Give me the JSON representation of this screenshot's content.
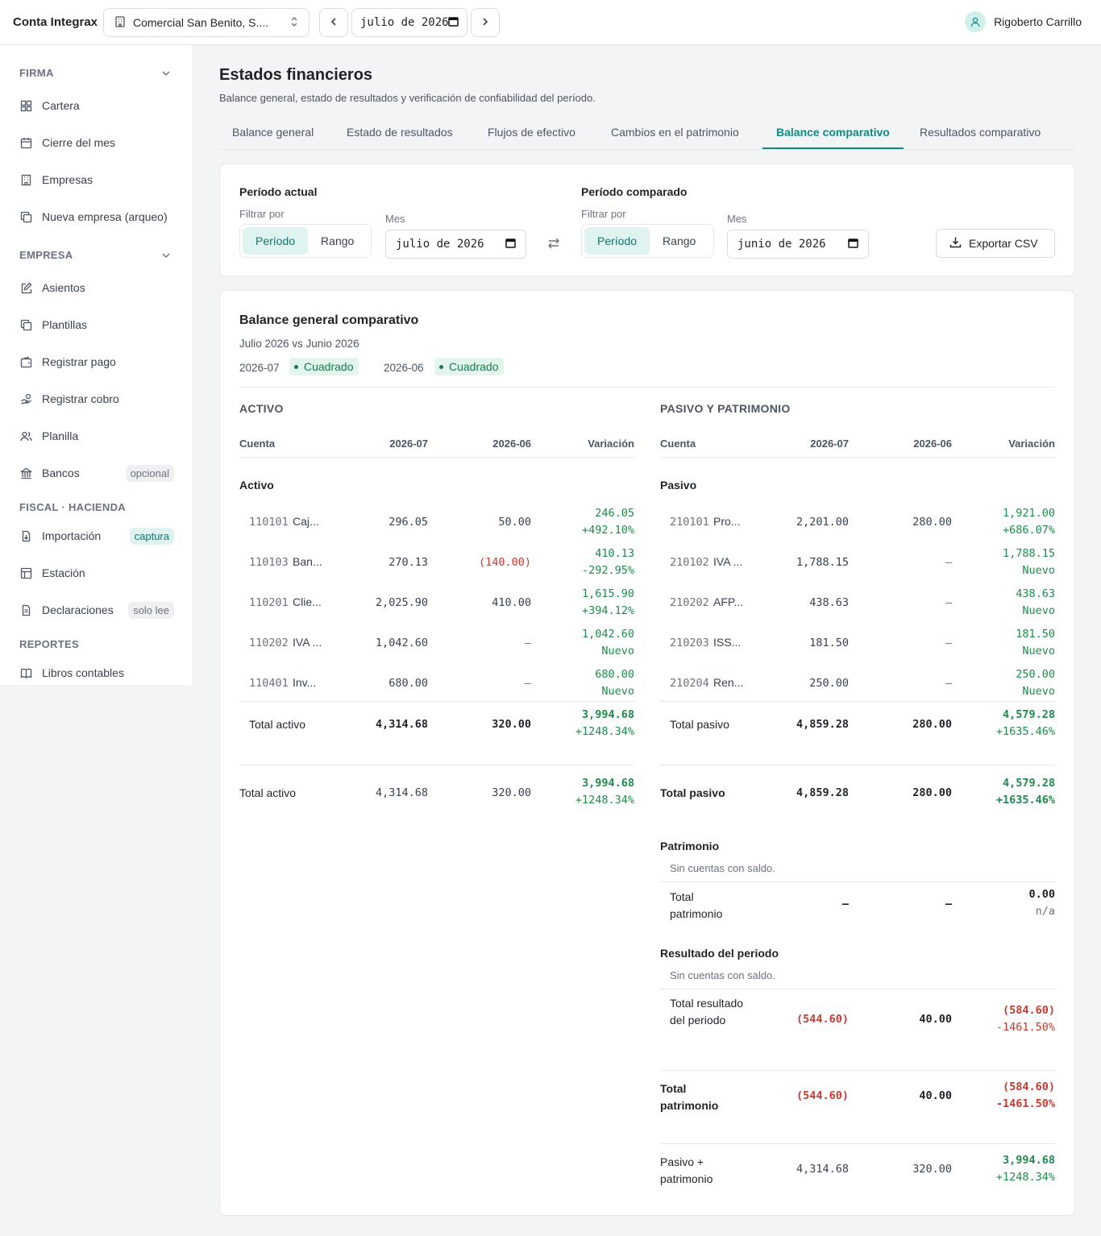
{
  "app": {
    "brand": "Conta Integrax",
    "company": "Comercial San Benito, S....",
    "month": "julio de 2026",
    "user": "Rigoberto Carrillo"
  },
  "sidebar": {
    "firma": {
      "title": "FIRMA",
      "items": [
        {
          "label": "Cartera",
          "icon": "grid-icon"
        },
        {
          "label": "Cierre del mes",
          "icon": "calendar-icon"
        },
        {
          "label": "Empresas",
          "icon": "building-icon"
        },
        {
          "label": "Nueva empresa (arqueo)",
          "icon": "copy-icon"
        }
      ]
    },
    "empresa": {
      "title": "EMPRESA",
      "items": [
        {
          "label": "Asientos",
          "icon": "edit-icon"
        },
        {
          "label": "Plantillas",
          "icon": "copy-icon"
        },
        {
          "label": "Registrar pago",
          "icon": "wallet-icon"
        },
        {
          "label": "Registrar cobro",
          "icon": "hand-coins-icon"
        },
        {
          "label": "Planilla",
          "icon": "users-icon"
        },
        {
          "label": "Bancos",
          "icon": "bank-icon",
          "pill": "opcional"
        }
      ]
    },
    "fiscal": {
      "title": "FISCAL · HACIENDA",
      "items": [
        {
          "label": "Importación",
          "icon": "file-import-icon",
          "pill": "captura"
        },
        {
          "label": "Estación",
          "icon": "table-icon"
        },
        {
          "label": "Declaraciones",
          "icon": "file-text-icon",
          "pill": "solo lee"
        }
      ]
    },
    "reportes": {
      "title": "REPORTES",
      "items": [
        {
          "label": "Libros contables",
          "icon": "book-icon"
        }
      ]
    }
  },
  "page": {
    "title": "Estados financieros",
    "subtitle": "Balance general, estado de resultados y verificación de confiabilidad del período.",
    "tabs": [
      "Balance general",
      "Estado de resultados",
      "Flujos de efectivo",
      "Cambios en el patrimonio",
      "Balance comparativo",
      "Resultados comparativo"
    ],
    "active_tab": "Balance comparativo"
  },
  "filters": {
    "actual": {
      "title": "Período actual",
      "filter_label": "Filtrar por",
      "opt1": "Período",
      "opt2": "Rango",
      "month_label": "Mes",
      "month": "julio de 2026"
    },
    "comparado": {
      "title": "Período comparado",
      "filter_label": "Filtrar por",
      "opt1": "Período",
      "opt2": "Rango",
      "month_label": "Mes",
      "month": "junio de 2026"
    },
    "export": "Exportar CSV"
  },
  "report": {
    "title": "Balance general comparativo",
    "subtitle": "Julio 2026 vs Junio 2026",
    "p1": "2026-07",
    "p1_status": "Cuadrado",
    "p2": "2026-06",
    "p2_status": "Cuadrado",
    "activo": {
      "heading": "ACTIVO",
      "cols": [
        "Cuenta",
        "2026-07",
        "2026-06",
        "Variación"
      ],
      "group": "Activo",
      "rows": [
        {
          "code": "110101",
          "name": "Caj...",
          "a": "296.05",
          "b": "50.00",
          "v": "246.05",
          "p": "+492.10%"
        },
        {
          "code": "110103",
          "name": "Ban...",
          "a": "270.13",
          "b": "(140.00)",
          "v": "410.13",
          "p": "-292.95%"
        },
        {
          "code": "110201",
          "name": "Clie...",
          "a": "2,025.90",
          "b": "410.00",
          "v": "1,615.90",
          "p": "+394.12%"
        },
        {
          "code": "110202",
          "name": "IVA ...",
          "a": "1,042.60",
          "b": "—",
          "v": "1,042.60",
          "p": "Nuevo"
        },
        {
          "code": "110401",
          "name": "Inv...",
          "a": "680.00",
          "b": "—",
          "v": "680.00",
          "p": "Nuevo"
        }
      ],
      "subtotal": {
        "label": "Total activo",
        "a": "4,314.68",
        "b": "320.00",
        "v": "3,994.68",
        "p": "+1248.34%"
      },
      "total": {
        "label": "Total activo",
        "a": "4,314.68",
        "b": "320.00",
        "v": "3,994.68",
        "p": "+1248.34%"
      }
    },
    "pasivo": {
      "heading": "PASIVO Y PATRIMONIO",
      "cols": [
        "Cuenta",
        "2026-07",
        "2026-06",
        "Variación"
      ],
      "group": "Pasivo",
      "rows": [
        {
          "code": "210101",
          "name": "Pro...",
          "a": "2,201.00",
          "b": "280.00",
          "v": "1,921.00",
          "p": "+686.07%"
        },
        {
          "code": "210102",
          "name": "IVA ...",
          "a": "1,788.15",
          "b": "—",
          "v": "1,788.15",
          "p": "Nuevo"
        },
        {
          "code": "210202",
          "name": "AFP...",
          "a": "438.63",
          "b": "—",
          "v": "438.63",
          "p": "Nuevo"
        },
        {
          "code": "210203",
          "name": "ISS...",
          "a": "181.50",
          "b": "—",
          "v": "181.50",
          "p": "Nuevo"
        },
        {
          "code": "210204",
          "name": "Ren...",
          "a": "250.00",
          "b": "—",
          "v": "250.00",
          "p": "Nuevo"
        }
      ],
      "subtotal": {
        "label": "Total pasivo",
        "a": "4,859.28",
        "b": "280.00",
        "v": "4,579.28",
        "p": "+1635.46%"
      },
      "total": {
        "label": "Total pasivo",
        "a": "4,859.28",
        "b": "280.00",
        "v": "4,579.28",
        "p": "+1635.46%"
      },
      "patrimonio": {
        "group": "Patrimonio",
        "empty": "Sin cuentas con saldo.",
        "total_label": "Total patrimonio",
        "a": "—",
        "b": "—",
        "v": "0.00",
        "p": "n/a"
      },
      "resultado": {
        "group": "Resultado del periodo",
        "empty": "Sin cuentas con saldo.",
        "total_label": "Total resultado del periodo",
        "a": "(544.60)",
        "b": "40.00",
        "v": "(584.60)",
        "p": "-1461.50%"
      },
      "total_patrimonio": {
        "label": "Total patrimonio",
        "a": "(544.60)",
        "b": "40.00",
        "v": "(584.60)",
        "p": "-1461.50%"
      },
      "pasivo_patrimonio": {
        "label": "Pasivo + patrimonio",
        "a": "4,314.68",
        "b": "320.00",
        "v": "3,994.68",
        "p": "+1248.34%"
      }
    }
  },
  "colors": {
    "accent": "#0f8a80",
    "positive": "#1f8a4c",
    "negative": "#c43a31"
  }
}
